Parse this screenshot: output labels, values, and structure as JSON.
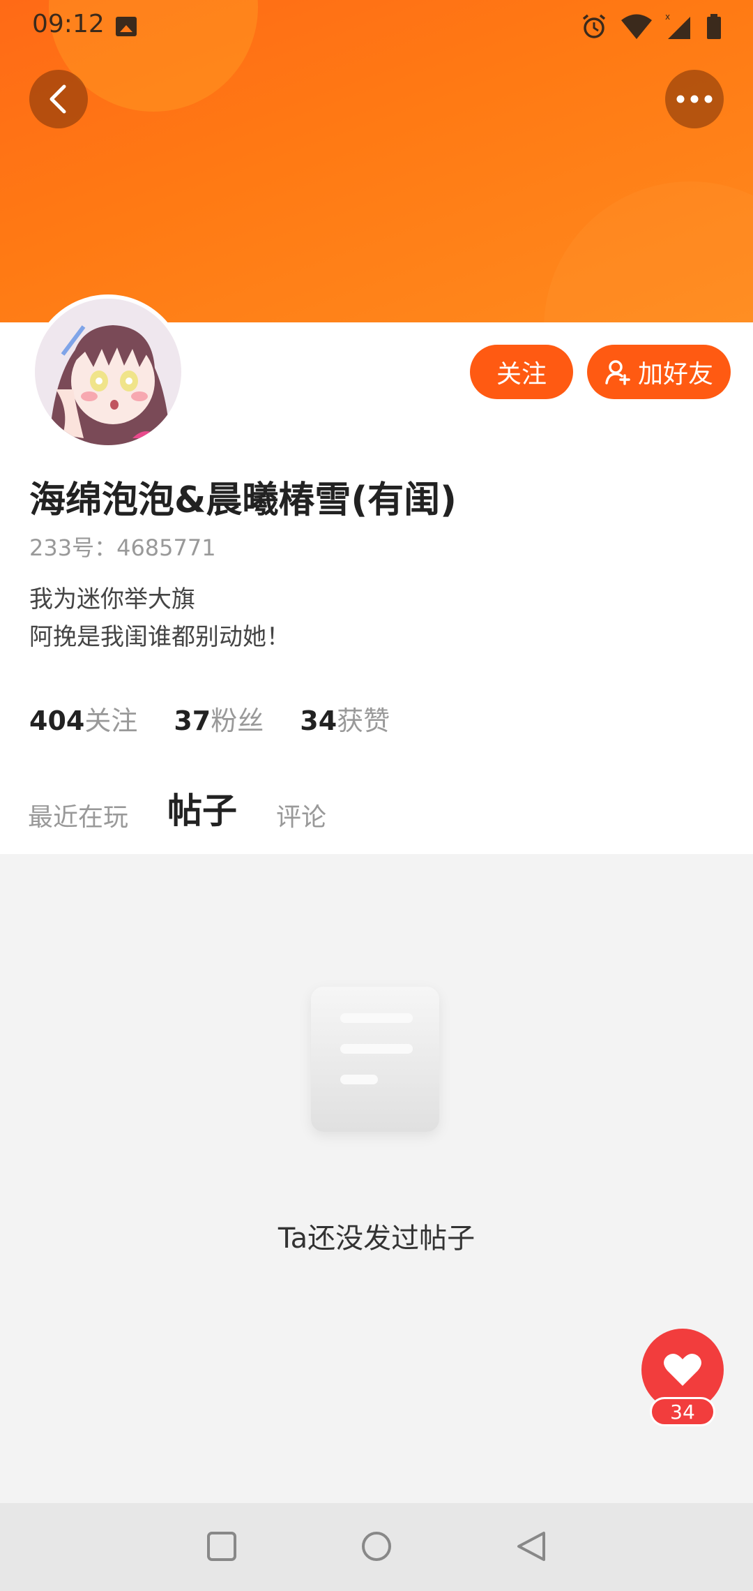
{
  "status_bar": {
    "time": "09:12",
    "icons": [
      "image-icon",
      "alarm-icon",
      "wifi-icon",
      "signal-icon",
      "battery-icon"
    ]
  },
  "header": {
    "back_icon": "chevron-left-icon",
    "more_icon": "more-dots-icon"
  },
  "profile": {
    "follow_label": "关注",
    "add_friend_label": "加好友",
    "name": "海绵泡泡&晨曦椿雪(有闺)",
    "uid": "233号：4685771",
    "bio_line1": "我为迷你举大旗",
    "bio_line2": "阿挽是我闺谁都别动她！"
  },
  "stats": [
    {
      "num": "404",
      "label": "关注"
    },
    {
      "num": "37",
      "label": "粉丝"
    },
    {
      "num": "34",
      "label": "获赞"
    }
  ],
  "tabs": [
    {
      "label": "最近在玩",
      "active": false
    },
    {
      "label": "帖子",
      "active": true
    },
    {
      "label": "评论",
      "active": false
    }
  ],
  "content": {
    "empty_text": "Ta还没发过帖子"
  },
  "fab": {
    "icon": "heart-icon",
    "count": "34"
  },
  "colors": {
    "accent": "#ff5a12",
    "banner": "#ff7a14",
    "like": "#f23d3d"
  }
}
